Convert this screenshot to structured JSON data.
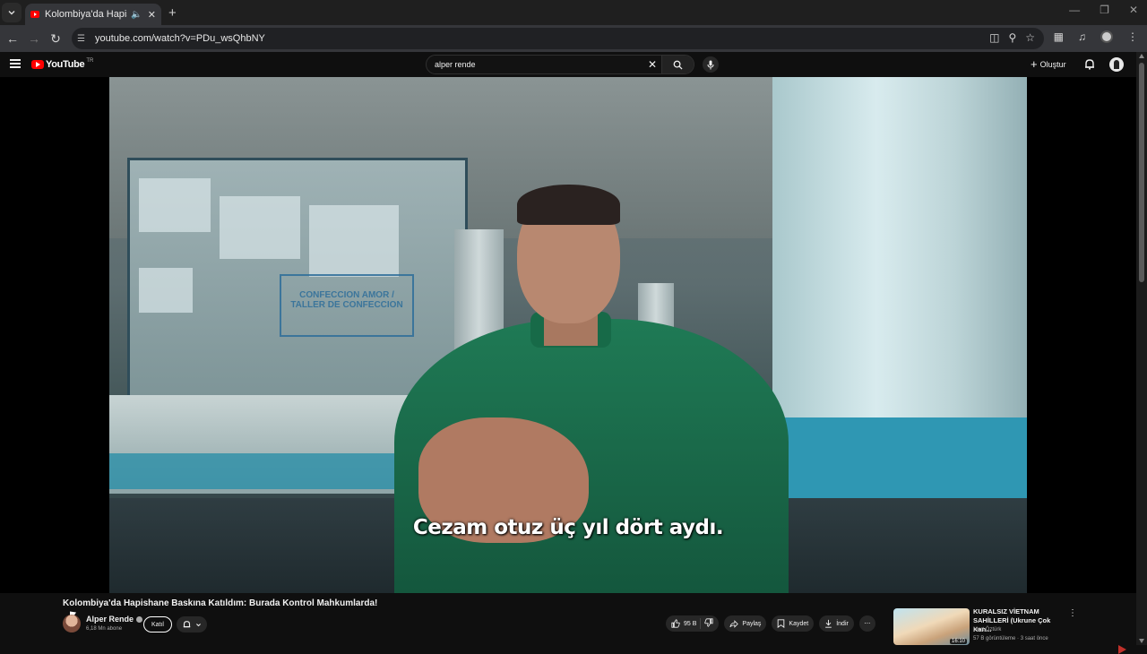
{
  "browser": {
    "tab_title": "Kolombiya'da Hapishane B",
    "url": "youtube.com/watch?v=PDu_wsQhbNY"
  },
  "masthead": {
    "logo_text": "YouTube",
    "country_code": "TR",
    "search_query": "alper rende",
    "create_label": "Oluştur"
  },
  "player": {
    "subtitle": "Cezam otuz üç yıl dört aydı.",
    "sign_text": "CONFECCION AMOR / TALLER DE CONFECCION"
  },
  "video": {
    "title": "Kolombiya'da Hapishane Baskına Katıldım: Burada Kontrol Mahkumlarda!",
    "channel_name": "Alper Rende",
    "subscribers": "6,18 Mn abone",
    "join_label": "Katıl",
    "like_count": "95 B",
    "share_label": "Paylaş",
    "save_label": "Kaydet",
    "download_label": "İndir"
  },
  "recommendation": {
    "title": "KURALSIZ VİETNAM SAHİLLERİ (Ukrune Çok Kan...",
    "channel": "Mert Öztürk",
    "meta": "57 B görüntüleme · 3 saat önce",
    "duration": "16:10"
  },
  "colors": {
    "yt_red": "#ff0000",
    "background": "#0f0f0f",
    "pill_bg": "#272727"
  }
}
